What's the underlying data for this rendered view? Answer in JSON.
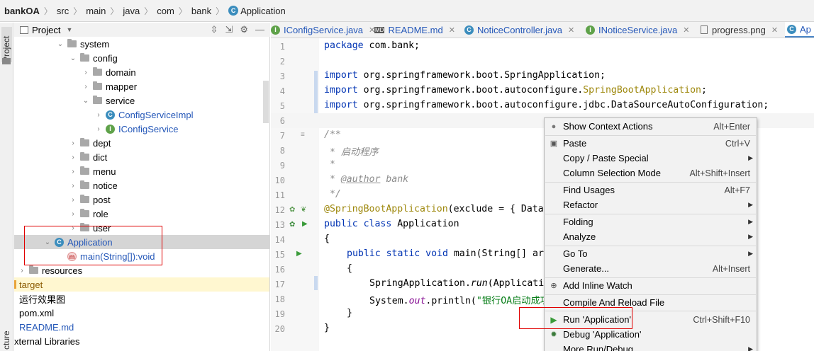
{
  "breadcrumb": [
    "bankOA",
    "src",
    "main",
    "java",
    "com",
    "bank",
    "Application"
  ],
  "stripe": {
    "top_label": "Project",
    "bottom_label": "cture"
  },
  "project_panel": {
    "title": "Project",
    "dropdown_icon": "chevron-down-icon"
  },
  "tree": [
    {
      "label": "system",
      "kind": "folder",
      "expanded": true,
      "color": "#000000"
    },
    {
      "label": "config",
      "kind": "folder",
      "expanded": true,
      "color": "#000000"
    },
    {
      "label": "domain",
      "kind": "folder",
      "expanded": false,
      "color": "#000000"
    },
    {
      "label": "mapper",
      "kind": "folder",
      "expanded": false,
      "color": "#000000"
    },
    {
      "label": "service",
      "kind": "folder",
      "expanded": true,
      "color": "#000000"
    },
    {
      "label": "ConfigServiceImpl",
      "kind": "class",
      "expanded": false,
      "color": "#2457b8"
    },
    {
      "label": "IConfigService",
      "kind": "interface",
      "expanded": false,
      "color": "#2457b8"
    },
    {
      "label": "dept",
      "kind": "folder",
      "expanded": false,
      "color": "#000000"
    },
    {
      "label": "dict",
      "kind": "folder",
      "expanded": false,
      "color": "#000000"
    },
    {
      "label": "menu",
      "kind": "folder",
      "expanded": false,
      "color": "#000000"
    },
    {
      "label": "notice",
      "kind": "folder",
      "expanded": false,
      "color": "#000000"
    },
    {
      "label": "post",
      "kind": "folder",
      "expanded": false,
      "color": "#000000"
    },
    {
      "label": "role",
      "kind": "folder",
      "expanded": false,
      "color": "#000000"
    },
    {
      "label": "user",
      "kind": "folder",
      "expanded": false,
      "color": "#000000"
    },
    {
      "label": "Application",
      "kind": "app",
      "expanded": true,
      "color": "#2457b8"
    },
    {
      "label": "main(String[]):void",
      "kind": "method",
      "expanded": false,
      "color": "#2457b8"
    },
    {
      "label": "resources",
      "kind": "folder",
      "expanded": false,
      "color": "#000000"
    },
    {
      "label": "target",
      "kind": "folder",
      "expanded": false,
      "color": "#8a5a00"
    },
    {
      "label": "运行效果图",
      "kind": "folder",
      "expanded": false,
      "color": "#000000"
    },
    {
      "label": "pom.xml",
      "kind": "file",
      "expanded": false,
      "color": "#000000"
    },
    {
      "label": "README.md",
      "kind": "file",
      "expanded": false,
      "color": "#2457b8"
    },
    {
      "label": "xternal Libraries",
      "kind": "lib",
      "expanded": false,
      "color": "#000000"
    }
  ],
  "tabs": [
    {
      "label": "IConfigService.java",
      "icon": "interface-icon",
      "color": "#2457b8"
    },
    {
      "label": "README.md",
      "icon": "markdown-icon",
      "color": "#2457b8"
    },
    {
      "label": "NoticeController.java",
      "icon": "class-icon",
      "color": "#2457b8"
    },
    {
      "label": "INoticeService.java",
      "icon": "interface-icon",
      "color": "#2457b8"
    },
    {
      "label": "progress.png",
      "icon": "image-icon",
      "color": "#000000"
    },
    {
      "label": "Ap",
      "icon": "class-icon",
      "color": "#2457b8"
    }
  ],
  "code": {
    "line_numbers": [
      "1",
      "2",
      "3",
      "4",
      "5",
      "6",
      "7",
      "8",
      "9",
      "10",
      "11",
      "12",
      "13",
      "14",
      "15",
      "16",
      "17",
      "18",
      "19",
      "20"
    ],
    "line1": {
      "kw": "package",
      "rest": " com.bank;"
    },
    "line3": {
      "kw": "import",
      "rest": " org.springframework.boot.SpringApplication;"
    },
    "line4": {
      "kw": "import",
      "pre": " org.springframework.boot.autoconfigure.",
      "ann": "SpringBootApplication",
      "post": ";"
    },
    "line5": {
      "kw": "import",
      "rest": " org.springframework.boot.autoconfigure.jdbc.DataSourceAutoConfiguration;"
    },
    "line7": "/**",
    "line8": " * 启动程序",
    "line9": " *",
    "line10": {
      "pre": " * ",
      "tag": "@author",
      "post": " bank"
    },
    "line11": " */",
    "line12": {
      "ann": "@SpringBootApplication",
      "rest": "(exclude = { Data"
    },
    "line13": {
      "kw": "public class",
      "rest": " Application"
    },
    "line14": "{",
    "line15": {
      "kw": "public static void",
      "rest": " main(String[] ar"
    },
    "line16": "{",
    "line17": {
      "pre": "SpringApplication.",
      "it": "run",
      "rest": "(Applicati"
    },
    "line18": {
      "pre": "System.",
      "it": "out",
      "mid": ".println(",
      "str": "\"银行OA启动成功"
    },
    "line19": "}",
    "line20": "}"
  },
  "context_menu": [
    {
      "label": "Show Context Actions",
      "shortcut": "Alt+Enter",
      "icon": "bulb-icon",
      "submenu": false
    },
    {
      "label": "Paste",
      "shortcut": "Ctrl+V",
      "icon": "paste-icon",
      "submenu": false
    },
    {
      "label": "Copy / Paste Special",
      "shortcut": "",
      "icon": "",
      "submenu": true
    },
    {
      "label": "Column Selection Mode",
      "shortcut": "Alt+Shift+Insert",
      "icon": "",
      "submenu": false
    },
    {
      "label": "Find Usages",
      "shortcut": "Alt+F7",
      "icon": "",
      "submenu": false
    },
    {
      "label": "Refactor",
      "shortcut": "",
      "icon": "",
      "submenu": true
    },
    {
      "label": "Folding",
      "shortcut": "",
      "icon": "",
      "submenu": true
    },
    {
      "label": "Analyze",
      "shortcut": "",
      "icon": "",
      "submenu": true
    },
    {
      "label": "Go To",
      "shortcut": "",
      "icon": "",
      "submenu": true
    },
    {
      "label": "Generate...",
      "shortcut": "Alt+Insert",
      "icon": "",
      "submenu": false
    },
    {
      "label": "Add Inline Watch",
      "shortcut": "",
      "icon": "watch-icon",
      "submenu": false
    },
    {
      "label": "Compile And Reload File",
      "shortcut": "",
      "icon": "",
      "submenu": false
    },
    {
      "label": "Run 'Application'",
      "shortcut": "Ctrl+Shift+F10",
      "icon": "run-icon",
      "submenu": false
    },
    {
      "label": "Debug 'Application'",
      "shortcut": "",
      "icon": "debug-icon",
      "submenu": false
    },
    {
      "label": "More Run/Debug",
      "shortcut": "",
      "icon": "",
      "submenu": true
    }
  ],
  "colors": {
    "accent_blue": "#2457b8",
    "highlight_red": "#e00000",
    "run_green": "#3a9b3a"
  }
}
